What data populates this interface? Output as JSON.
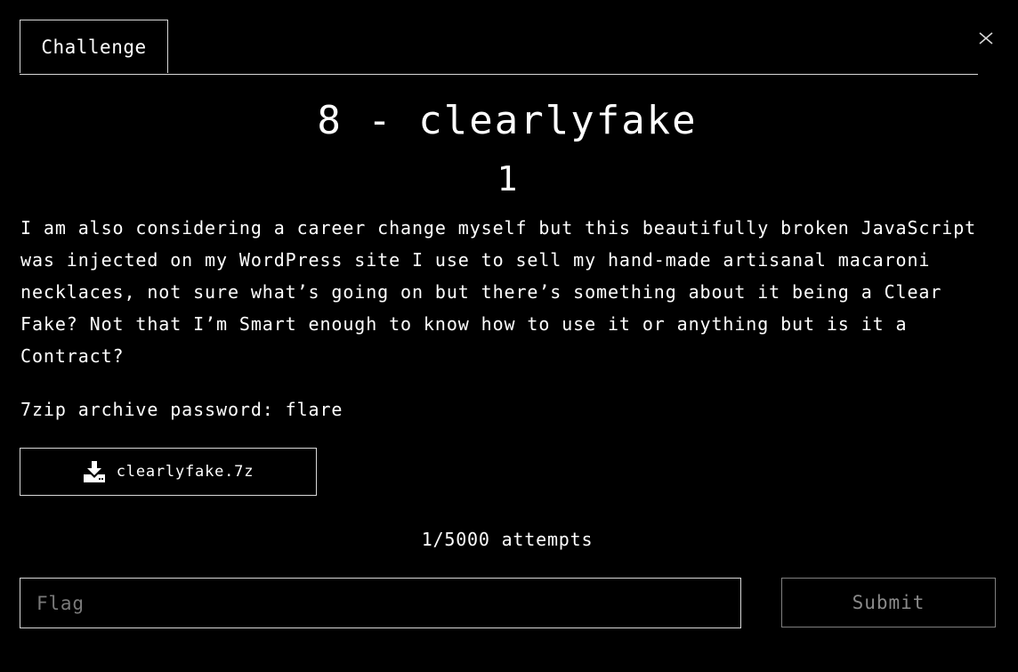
{
  "tabs": [
    {
      "label": "Challenge"
    }
  ],
  "close_icon": "close-collapse-icon",
  "challenge": {
    "title": "8 - clearlyfake",
    "points": "1",
    "description": "I am also considering a career change myself but this beautifully broken JavaScript was injected on my WordPress site I use to sell my hand-made artisanal macaroni necklaces, not sure what’s going on but there’s something about it being a Clear Fake? Not that I’m Smart enough to know how to use it or anything but is it a Contract?",
    "password_note": "7zip archive password: flare"
  },
  "file": {
    "name": "clearlyfake.7z",
    "icon": "download-icon"
  },
  "attempts": "1/5000 attempts",
  "flag_input": {
    "placeholder": "Flag",
    "value": ""
  },
  "submit": {
    "label": "Submit"
  },
  "colors": {
    "background": "#000000",
    "foreground": "#ffffff",
    "border": "#d8d8d8",
    "muted": "#7a7a7a"
  }
}
